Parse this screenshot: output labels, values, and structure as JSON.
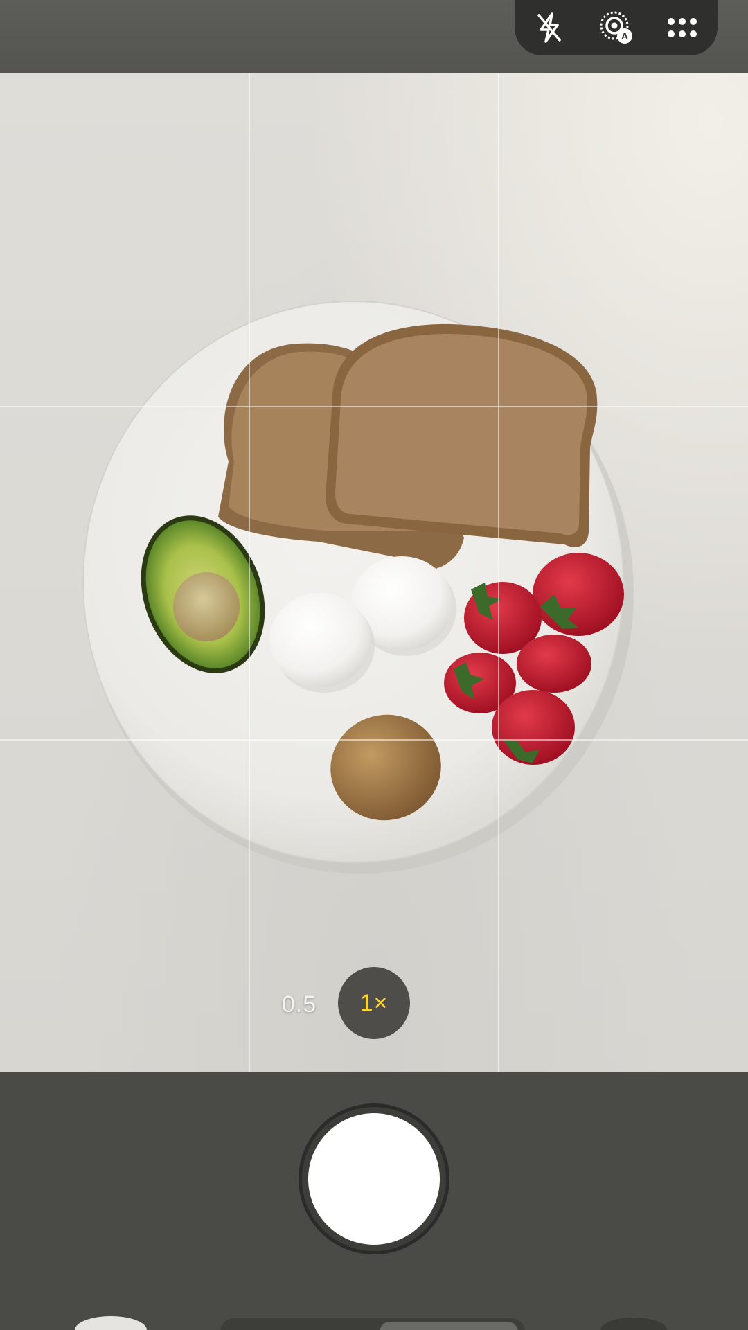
{
  "top_controls": {
    "icons": [
      "flash-off-icon",
      "auto-stabilize-icon",
      "more-grid-icon"
    ],
    "auto_badge": "A"
  },
  "zoom": {
    "options": [
      "0.5",
      "1×"
    ],
    "selected": "1×",
    "selected_color": "#ffd524"
  },
  "colors": {
    "background": "#4a4a47",
    "shutter": "#ffffff"
  }
}
